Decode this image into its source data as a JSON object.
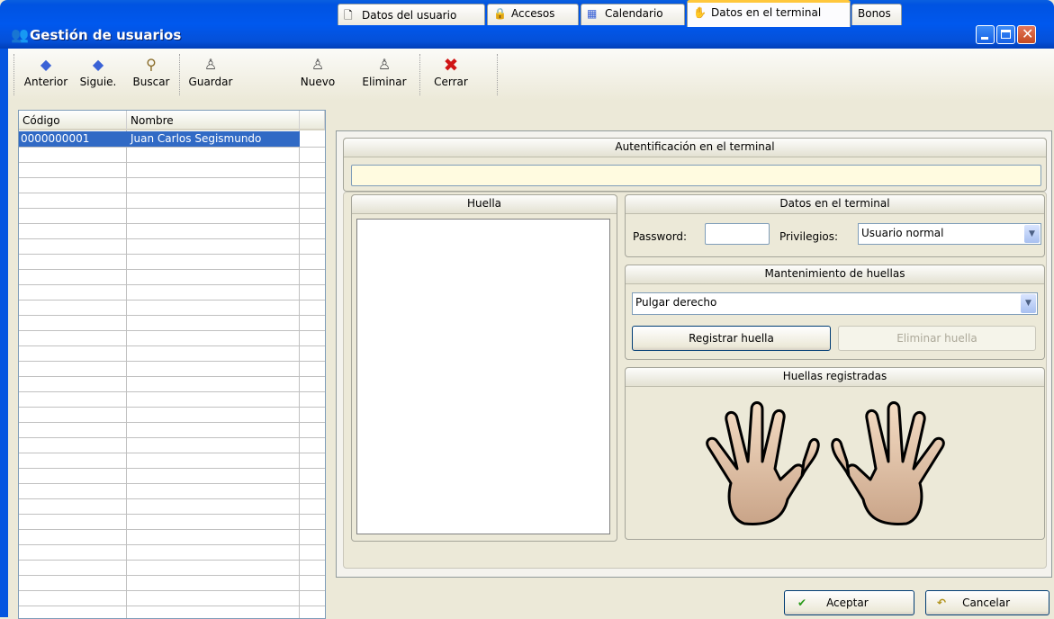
{
  "window": {
    "title": "Gestión de usuarios"
  },
  "toolbar": [
    {
      "label": "Anterior",
      "icon": "arrow-left-icon"
    },
    {
      "label": "Siguie.",
      "icon": "arrow-right-icon"
    },
    {
      "label": "Buscar",
      "icon": "magnifier-icon"
    },
    {
      "label": "Guardar",
      "icon": "save-user-icon"
    },
    {
      "label": "Nuevo",
      "icon": "new-user-icon"
    },
    {
      "label": "Eliminar",
      "icon": "delete-user-icon"
    },
    {
      "label": "Cerrar",
      "icon": "close-x-icon"
    }
  ],
  "grid": {
    "columns": [
      "Código",
      "Nombre"
    ],
    "rows": [
      {
        "codigo": "0000000001",
        "nombre": "Juan Carlos Segismundo"
      }
    ]
  },
  "tabs": [
    "Datos del usuario",
    "Accesos",
    "Calendario",
    "Datos en el terminal",
    "Bonos"
  ],
  "active_tab": "Datos en el terminal",
  "auth": {
    "title": "Autentificación en el terminal",
    "value": ""
  },
  "huella": {
    "title": "Huella"
  },
  "terminal": {
    "title": "Datos en el terminal",
    "password_label": "Password:",
    "password_value": "",
    "privilegios_label": "Privilegios:",
    "privilegios_value": "Usuario normal"
  },
  "mantenimiento": {
    "title": "Mantenimiento de huellas",
    "finger_value": "Pulgar derecho",
    "register_label": "Registrar huella",
    "delete_label": "Eliminar huella"
  },
  "registradas": {
    "title": "Huellas registradas"
  },
  "footer": {
    "accept_label": "Aceptar",
    "cancel_label": "Cancelar"
  },
  "colors": {
    "title_bar": "#0058ee",
    "selection": "#316ac5",
    "active_tab_border": "#ffc73c"
  }
}
